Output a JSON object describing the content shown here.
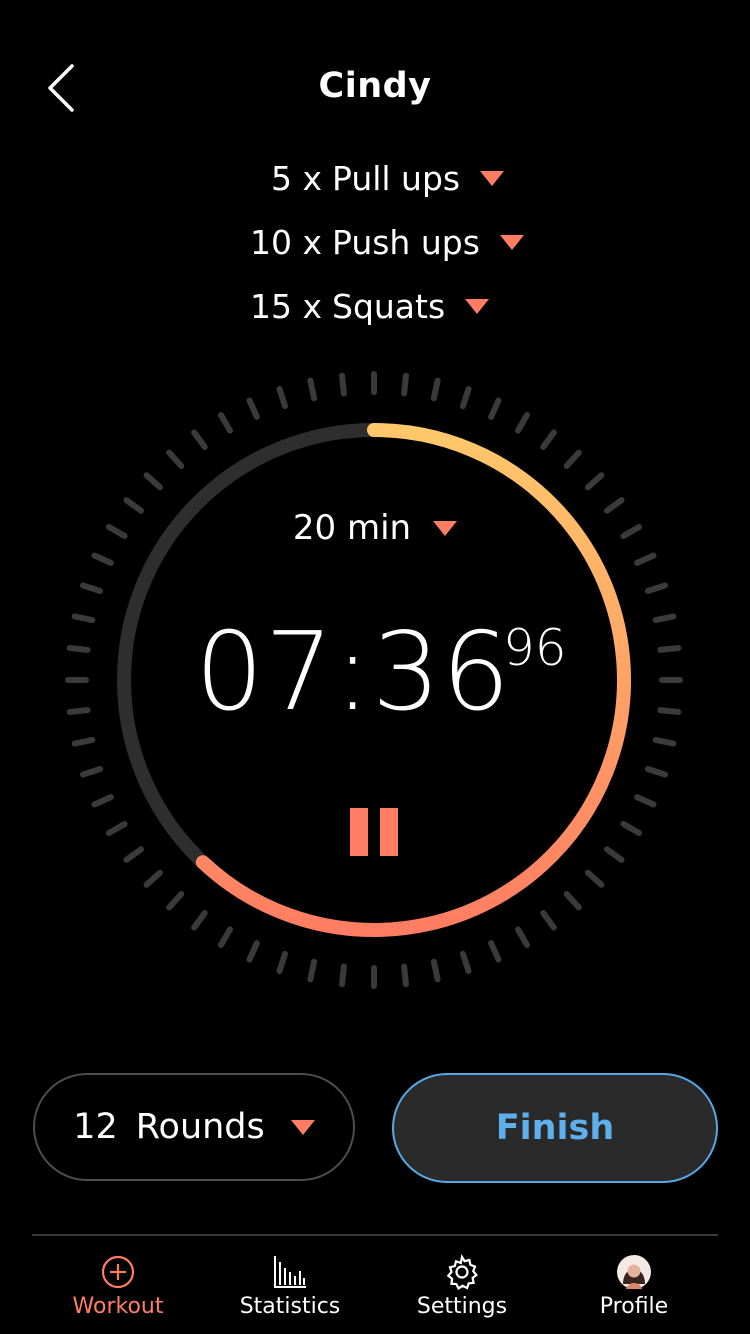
{
  "header": {
    "title": "Cindy",
    "back_icon": "chevron-left-icon"
  },
  "exercises": [
    {
      "qty": "5 x",
      "name": "Pull ups"
    },
    {
      "qty": "10 x",
      "name": "Push ups"
    },
    {
      "qty": "15 x",
      "name": "Squats"
    }
  ],
  "timer": {
    "duration_label": "20 min",
    "time": "07:36",
    "centiseconds": "96",
    "progress": 0.62,
    "pause_icon": "pause-icon"
  },
  "controls": {
    "rounds_count": "12",
    "rounds_label": "Rounds",
    "finish_label": "Finish"
  },
  "tabs": [
    {
      "label": "Workout",
      "icon": "plus-circle-icon",
      "active": true
    },
    {
      "label": "Statistics",
      "icon": "bar-chart-icon",
      "active": false
    },
    {
      "label": "Settings",
      "icon": "gear-icon",
      "active": false
    },
    {
      "label": "Profile",
      "icon": "avatar-icon",
      "active": false
    }
  ],
  "colors": {
    "accent": "#ff7d62",
    "gradient_start": "#ffc86a",
    "finish_blue": "#5eb0ec",
    "track": "#2e2e2e",
    "tick": "#3a3a3a",
    "background": "#000000"
  }
}
